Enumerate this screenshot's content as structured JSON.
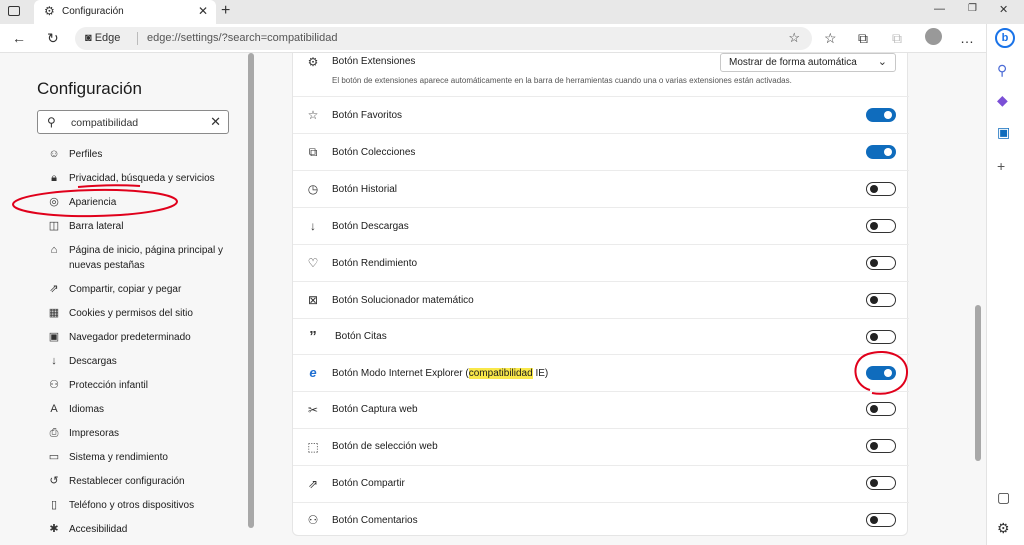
{
  "tab": {
    "title": "Configuración"
  },
  "address": {
    "brand": "Edge",
    "url": "edge://settings/?search=compatibilidad"
  },
  "nav": {
    "title": "Configuración",
    "search_value": "compatibilidad",
    "items": [
      {
        "label": "Perfiles",
        "icon": "profile-icon"
      },
      {
        "label": "Privacidad, búsqueda y servicios",
        "icon": "lock-icon"
      },
      {
        "label": "Apariencia",
        "icon": "palette-icon"
      },
      {
        "label": "Barra lateral",
        "icon": "sidebar-icon"
      },
      {
        "label": "Página de inicio, página principal y nuevas pestañas",
        "icon": "home-icon"
      },
      {
        "label": "Compartir, copiar y pegar",
        "icon": "share-icon"
      },
      {
        "label": "Cookies y permisos del sitio",
        "icon": "cookie-icon"
      },
      {
        "label": "Navegador predeterminado",
        "icon": "browser-icon"
      },
      {
        "label": "Descargas",
        "icon": "download-icon"
      },
      {
        "label": "Protección infantil",
        "icon": "family-icon"
      },
      {
        "label": "Idiomas",
        "icon": "language-icon"
      },
      {
        "label": "Impresoras",
        "icon": "printer-icon"
      },
      {
        "label": "Sistema y rendimiento",
        "icon": "system-icon"
      },
      {
        "label": "Restablecer configuración",
        "icon": "reset-icon"
      },
      {
        "label": "Teléfono y otros dispositivos",
        "icon": "phone-icon"
      },
      {
        "label": "Accesibilidad",
        "icon": "accessibility-icon"
      }
    ]
  },
  "extensions": {
    "label": "Botón Extensiones",
    "description": "El botón de extensiones aparece automáticamente en la barra de herramientas cuando una o varias extensiones están activadas.",
    "select_value": "Mostrar de forma automática"
  },
  "rows": [
    {
      "label": "Botón Favoritos",
      "on": true,
      "icon": "favorites-icon"
    },
    {
      "label": "Botón Colecciones",
      "on": true,
      "icon": "collections-icon"
    },
    {
      "label": "Botón Historial",
      "on": false,
      "icon": "history-icon"
    },
    {
      "label": "Botón Descargas",
      "on": false,
      "icon": "download-icon"
    },
    {
      "label": "Botón Rendimiento",
      "on": false,
      "icon": "performance-icon"
    },
    {
      "label": "Botón Solucionador matemático",
      "on": false,
      "icon": "math-icon"
    },
    {
      "label": "Botón Citas",
      "on": false,
      "icon": "quote-icon"
    },
    {
      "label_pre": "Botón Modo Internet Explorer (",
      "label_hl": "compatibilidad",
      "label_post": " IE)",
      "on": true,
      "icon": "ie-icon"
    },
    {
      "label": "Botón Captura web",
      "on": false,
      "icon": "capture-icon"
    },
    {
      "label": "Botón de selección web",
      "on": false,
      "icon": "select-icon"
    },
    {
      "label": "Botón Compartir",
      "on": false,
      "icon": "share-icon"
    },
    {
      "label": "Botón Comentarios",
      "on": false,
      "icon": "feedback-icon"
    }
  ],
  "colors": {
    "accent": "#0f6cbd",
    "highlight": "#f9e84a",
    "annotation": "#e0001b"
  }
}
